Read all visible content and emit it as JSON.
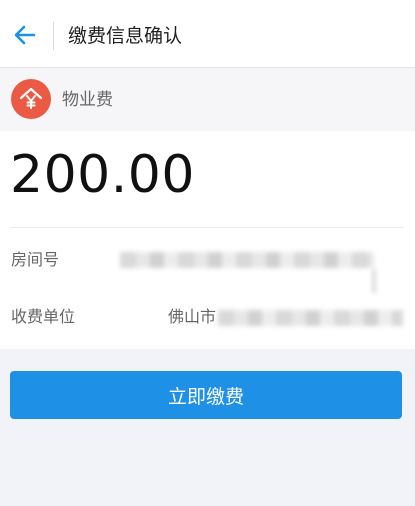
{
  "header": {
    "title": "缴费信息确认",
    "back_icon": "arrow-left-icon"
  },
  "fee": {
    "icon": "yuan-house-icon",
    "label": "物业费",
    "amount": "200.00"
  },
  "details": [
    {
      "label": "房间号",
      "value": ""
    },
    {
      "label": "收费单位",
      "value": "佛山市"
    }
  ],
  "actions": {
    "pay_label": "立即缴费"
  },
  "colors": {
    "accent": "#1e90e6",
    "fee_icon_bg": "#ea5a45",
    "page_bg": "#f2f3f8"
  }
}
